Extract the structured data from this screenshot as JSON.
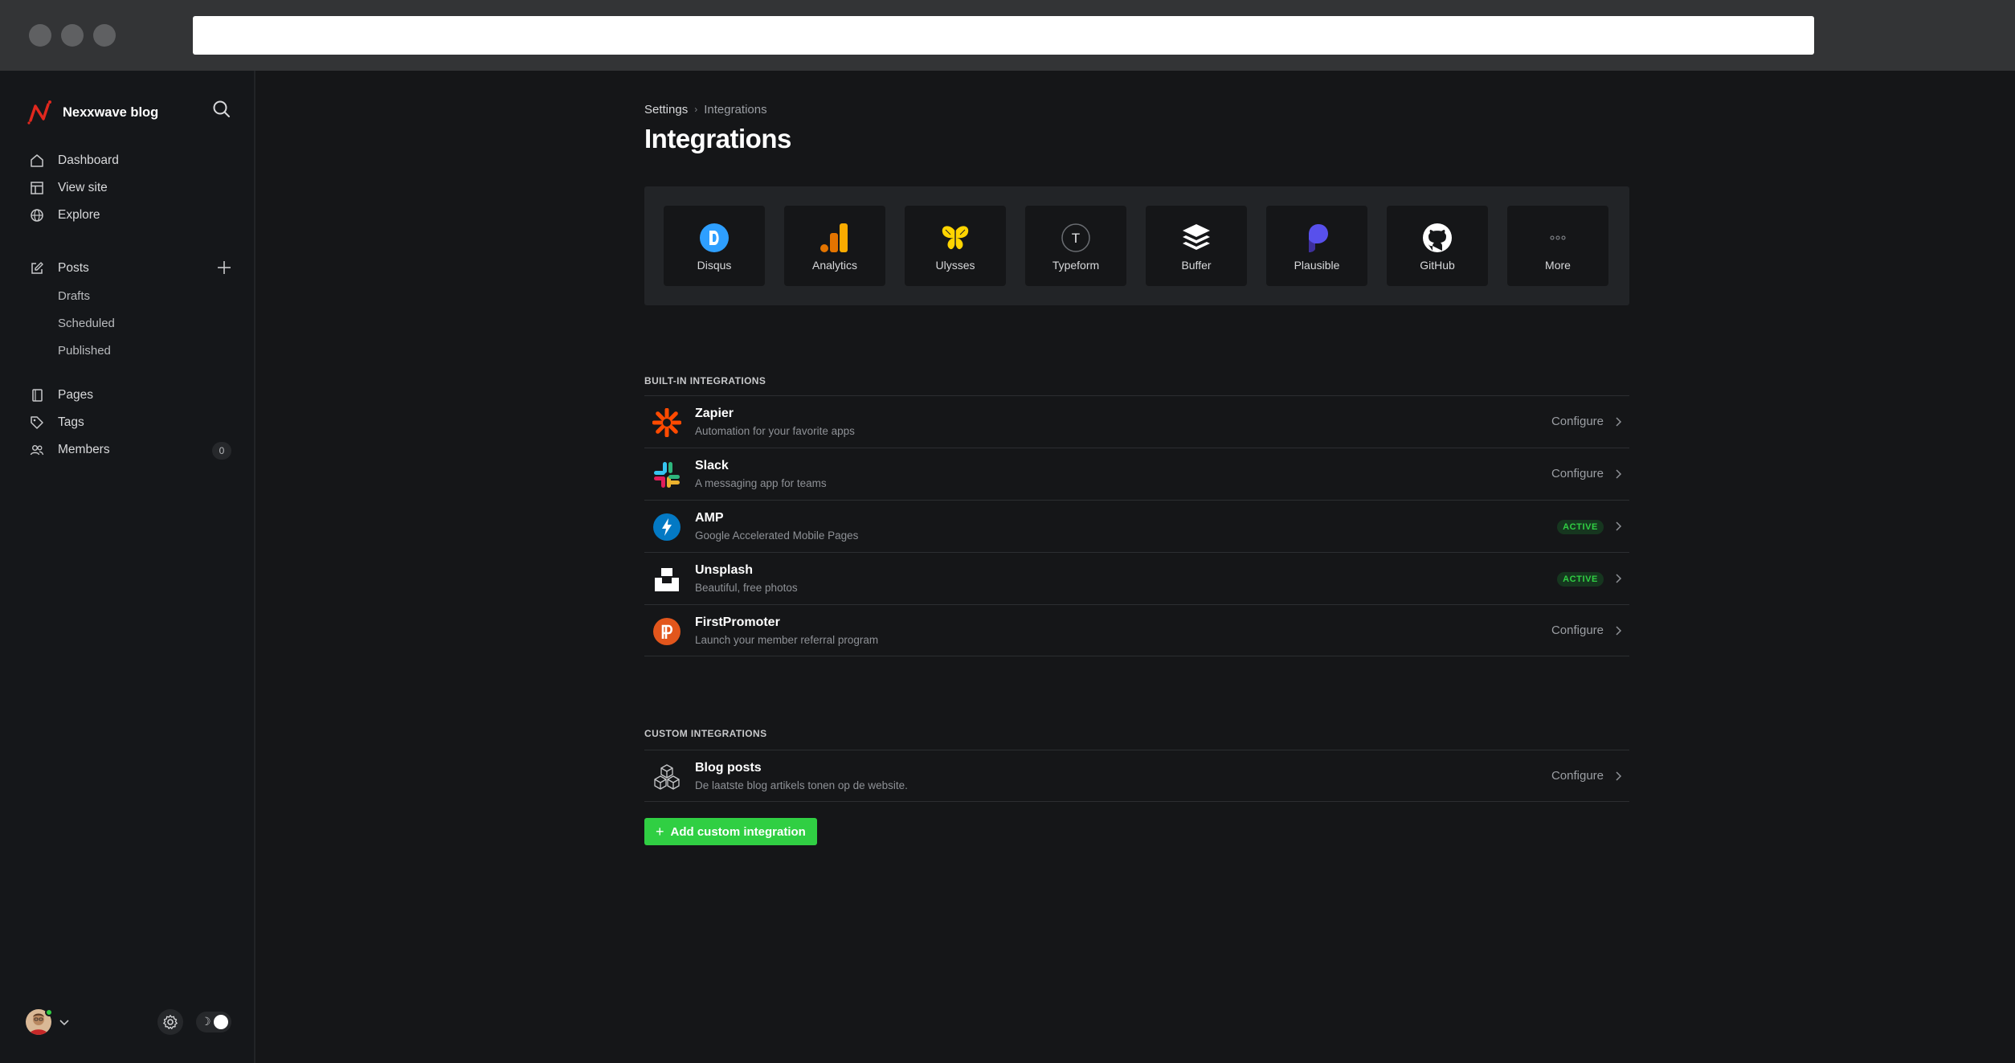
{
  "site": {
    "name": "Nexxwave blog"
  },
  "nav": {
    "main": [
      {
        "label": "Dashboard",
        "icon": "home-icon"
      },
      {
        "label": "View site",
        "icon": "layout-icon"
      },
      {
        "label": "Explore",
        "icon": "globe-icon"
      }
    ],
    "posts": {
      "label": "Posts",
      "icon": "edit-icon"
    },
    "posts_sub": [
      "Drafts",
      "Scheduled",
      "Published"
    ],
    "secondary": [
      {
        "label": "Pages",
        "icon": "page-icon"
      },
      {
        "label": "Tags",
        "icon": "tag-icon"
      },
      {
        "label": "Members",
        "icon": "members-icon"
      }
    ],
    "members_count": "0"
  },
  "breadcrumb": {
    "parent": "Settings",
    "current": "Integrations"
  },
  "page_title": "Integrations",
  "apps": [
    "Disqus",
    "Analytics",
    "Ulysses",
    "Typeform",
    "Buffer",
    "Plausible",
    "GitHub",
    "More"
  ],
  "builtin": {
    "label": "BUILT-IN INTEGRATIONS",
    "items": [
      {
        "title": "Zapier",
        "desc": "Automation for your favorite apps",
        "action": "Configure"
      },
      {
        "title": "Slack",
        "desc": "A messaging app for teams",
        "action": "Configure"
      },
      {
        "title": "AMP",
        "desc": "Google Accelerated Mobile Pages",
        "action": "ACTIVE"
      },
      {
        "title": "Unsplash",
        "desc": "Beautiful, free photos",
        "action": "ACTIVE"
      },
      {
        "title": "FirstPromoter",
        "desc": "Launch your member referral program",
        "action": "Configure"
      }
    ]
  },
  "custom": {
    "label": "CUSTOM INTEGRATIONS",
    "items": [
      {
        "title": "Blog posts",
        "desc": "De laatste blog artikels tonen op de website.",
        "action": "Configure"
      }
    ]
  },
  "add_button": "Add custom integration",
  "colors": {
    "accent": "#30cf43",
    "background": "#151618",
    "panel": "#222427"
  }
}
